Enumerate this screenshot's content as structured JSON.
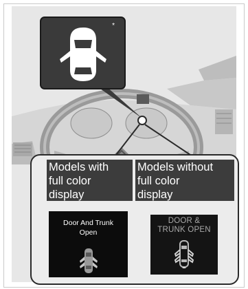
{
  "callout": {
    "asterisk": "*",
    "icon": "door-open-car-top-view-icon"
  },
  "labels": {
    "full_color": "Models with\nfull color\ndisplay",
    "without_full_color": "Models without\nfull color\ndisplay"
  },
  "displays": {
    "full_color_message": "Door And Trunk\nOpen",
    "basic_message": "DOOR &\nTRUNK OPEN"
  },
  "colors": {
    "background_panel": "#e7e7e7",
    "callout_fill": "#3a3a3a",
    "label_fill": "#3c3c3c",
    "screen_fill": "#0c0c0c"
  }
}
